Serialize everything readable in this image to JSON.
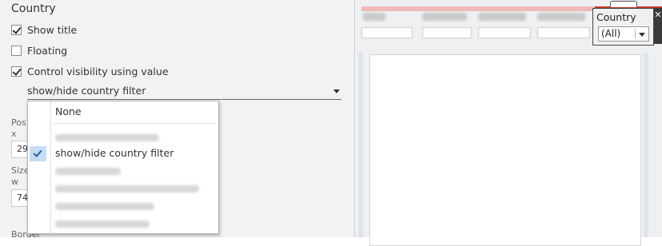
{
  "panel": {
    "section_title": "Country",
    "show_title_label": "Show title",
    "show_title_checked": true,
    "floating_label": "Floating",
    "floating_checked": false,
    "control_visibility_label": "Control visibility using value",
    "control_visibility_checked": true,
    "visibility_value": "show/hide country filter",
    "position_label": "Pos",
    "x_label": "x",
    "x_value": "29",
    "size_label": "Size",
    "w_label": "w",
    "w_value": "74",
    "border_label": "Border"
  },
  "menu": {
    "none_label": "None",
    "selected_label": "show/hide country filter",
    "selected_index": 1
  },
  "country_filter": {
    "title": "Country",
    "selected_value": "(All)",
    "close_glyph": "✕"
  },
  "colors": {
    "accent_selection": "#c5dcf3",
    "check_color": "#1f5fa8",
    "header_bar": "#f1b9b9",
    "header_line": "#c0392b"
  }
}
